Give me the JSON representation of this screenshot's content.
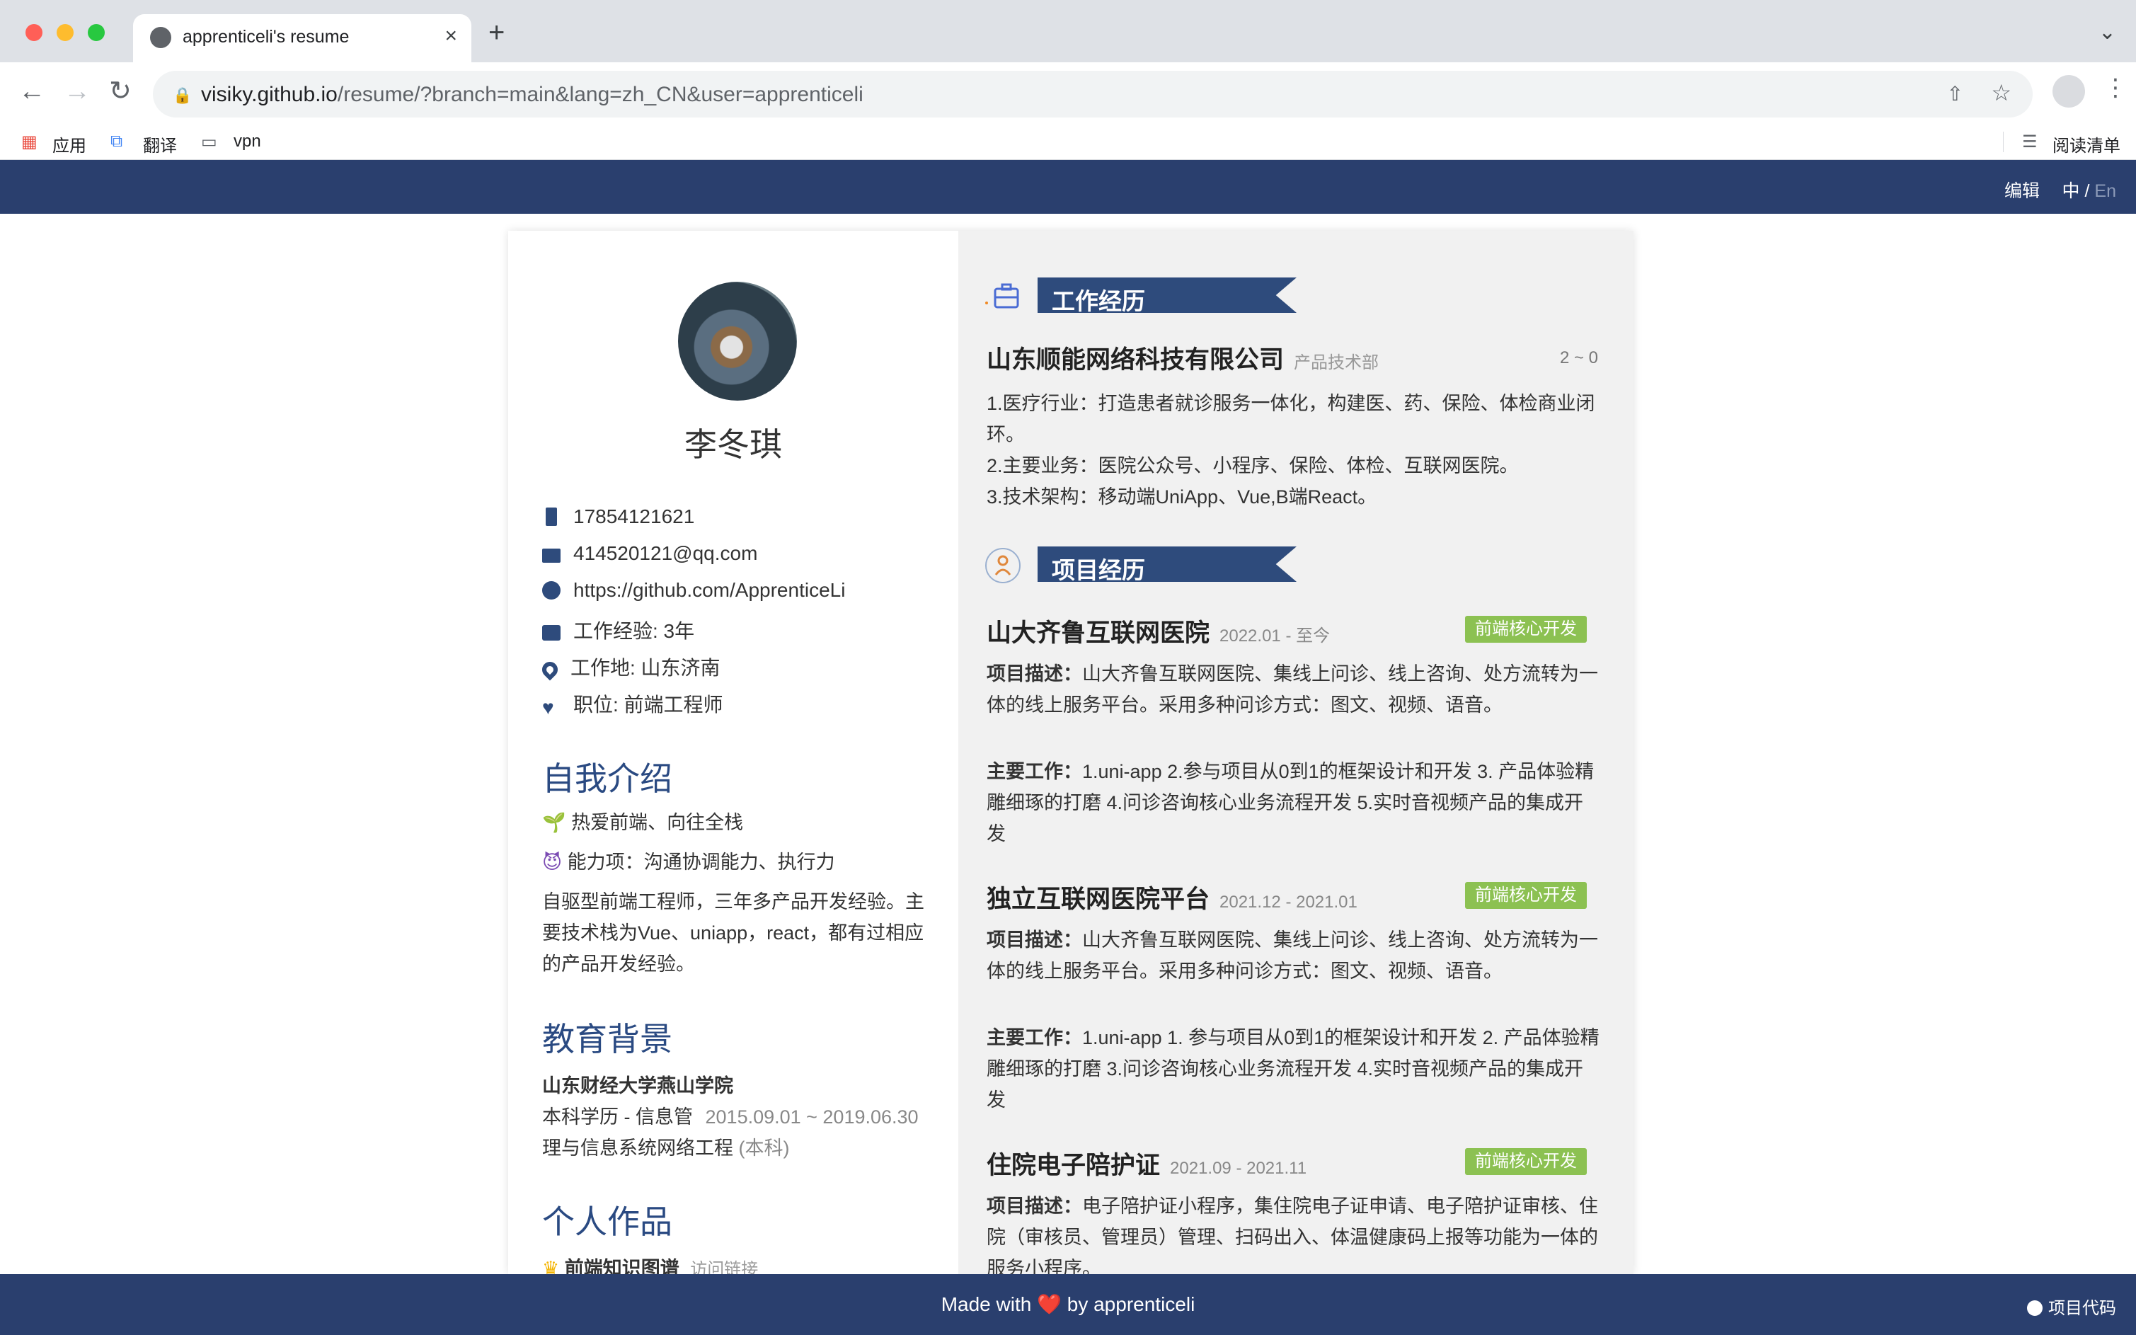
{
  "browser": {
    "tab_title": "apprenticeli's resume",
    "tab_close": "×",
    "new_tab": "+",
    "url_host": "visiky.github.io",
    "url_path": "/resume/?branch=main&lang=zh_CN&user=apprenticeli",
    "bookmarks": [
      "应用",
      "翻译",
      "vpn"
    ],
    "reading_list": "阅读清单"
  },
  "header": {
    "edit": "编辑",
    "lang_zh": "中",
    "lang_sep": "/",
    "lang_en": "En"
  },
  "profile": {
    "name": "李冬琪",
    "phone": "17854121621",
    "email": "414520121@qq.com",
    "github": "https://github.com/ApprenticeLi",
    "experience": "工作经验: 3年",
    "location": "工作地: 山东济南",
    "position": "职位: 前端工程师"
  },
  "about": {
    "title": "自我介绍",
    "line1": "热爱前端、向往全栈",
    "line2": "能力项：沟通协调能力、执行力",
    "desc": "自驱型前端工程师，三年多产品开发经验。主要技术栈为Vue、uniapp，react，都有过相应的产品开发经验。"
  },
  "education": {
    "title": "教育背景",
    "school": "山东财经大学燕山学院",
    "degree": "本科学历 - 信息管",
    "dates": "2015.09.01 ~ 2019.06.30",
    "major": "理与信息系统网络工程",
    "level": "(本科)"
  },
  "works": {
    "title": "个人作品",
    "item": "前端知识图谱",
    "link": "访问链接"
  },
  "work_exp": {
    "title": "工作经历",
    "company": "山东顺能网络科技有限公司",
    "dept": "产品技术部",
    "dates": "2 ~ 0",
    "lines": [
      "1.医疗行业：打造患者就诊服务一体化，构建医、药、保险、体检商业闭环。",
      "2.主要业务：医院公众号、小程序、保险、体检、互联网医院。",
      "3.技术架构：移动端UniApp、Vue,B端React。"
    ]
  },
  "projects": {
    "title": "项目经历",
    "desc_label": "项目描述：",
    "work_label": "主要工作：",
    "items": [
      {
        "name": "山大齐鲁互联网医院",
        "dates": "2022.01 - 至今",
        "tag": "前端核心开发",
        "desc": "山大齐鲁互联网医院、集线上问诊、线上咨询、处方流转为一体的线上服务平台。采用多种问诊方式：图文、视频、语音。",
        "work": "1.uni-app 2.参与项目从0到1的框架设计和开发 3. 产品体验精雕细琢的打磨 4.问诊咨询核心业务流程开发 5.实时音视频产品的集成开发"
      },
      {
        "name": "独立互联网医院平台",
        "dates": "2021.12 - 2021.01",
        "tag": "前端核心开发",
        "desc": "山大齐鲁互联网医院、集线上问诊、线上咨询、处方流转为一体的线上服务平台。采用多种问诊方式：图文、视频、语音。",
        "work": "1.uni-app 1. 参与项目从0到1的框架设计和开发 2. 产品体验精雕细琢的打磨 3.问诊咨询核心业务流程开发 4.实时音视频产品的集成开发"
      },
      {
        "name": "住院电子陪护证",
        "dates": "2021.09 - 2021.11",
        "tag": "前端核心开发",
        "desc": "电子陪护证小程序，集住院电子证申请、电子陪护证审核、住院（审核员、管理员）管理、扫码出入、体温健康码上报等功能为一体的服务小程序。"
      }
    ]
  },
  "footer": {
    "made_with": "Made with",
    "heart": "❤️",
    "by": "by apprenticeli",
    "source": "项目代码"
  },
  "colors": {
    "navy": "#2a3f6e",
    "tag_green": "#8cc152",
    "heading_blue": "#2a4a82"
  }
}
